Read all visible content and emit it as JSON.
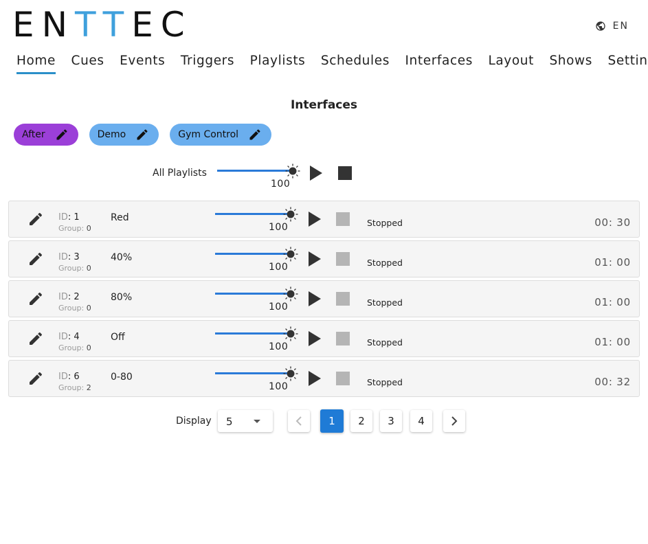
{
  "logo": {
    "part1": "EN",
    "part2": "TT",
    "part3": "EC"
  },
  "language": "EN",
  "nav": [
    {
      "label": "Home",
      "active": true
    },
    {
      "label": "Cues"
    },
    {
      "label": "Events"
    },
    {
      "label": "Triggers"
    },
    {
      "label": "Playlists"
    },
    {
      "label": "Schedules"
    },
    {
      "label": "Interfaces"
    },
    {
      "label": "Layout"
    },
    {
      "label": "Shows"
    },
    {
      "label": "Settings"
    }
  ],
  "page_title": "Interfaces",
  "chips": [
    {
      "label": "After",
      "color": "#9b3fd8"
    },
    {
      "label": "Demo",
      "color": "#6aaeee"
    },
    {
      "label": "Gym Control",
      "color": "#6aaeee"
    }
  ],
  "all_playlists": {
    "label": "All Playlists",
    "value": "100"
  },
  "rows": [
    {
      "id_key": "ID",
      "id": "1",
      "group_key": "Group",
      "group": "0",
      "name": "Red",
      "value": "100",
      "status": "Stopped",
      "time": "00: 30"
    },
    {
      "id_key": "ID",
      "id": "3",
      "group_key": "Group",
      "group": "0",
      "name": "40%",
      "value": "100",
      "status": "Stopped",
      "time": "01: 00"
    },
    {
      "id_key": "ID",
      "id": "2",
      "group_key": "Group",
      "group": "0",
      "name": "80%",
      "value": "100",
      "status": "Stopped",
      "time": "01: 00"
    },
    {
      "id_key": "ID",
      "id": "4",
      "group_key": "Group",
      "group": "0",
      "name": "Off",
      "value": "100",
      "status": "Stopped",
      "time": "01: 00"
    },
    {
      "id_key": "ID",
      "id": "6",
      "group_key": "Group",
      "group": "2",
      "name": "0-80",
      "value": "100",
      "status": "Stopped",
      "time": "00: 32"
    }
  ],
  "pagination": {
    "display_label": "Display",
    "display_value": "5",
    "pages": [
      "1",
      "2",
      "3",
      "4"
    ],
    "current_page": "1"
  },
  "colors": {
    "accent": "#2a8fc9",
    "slider": "#2a7ad8",
    "page_active": "#1f7bd6"
  }
}
